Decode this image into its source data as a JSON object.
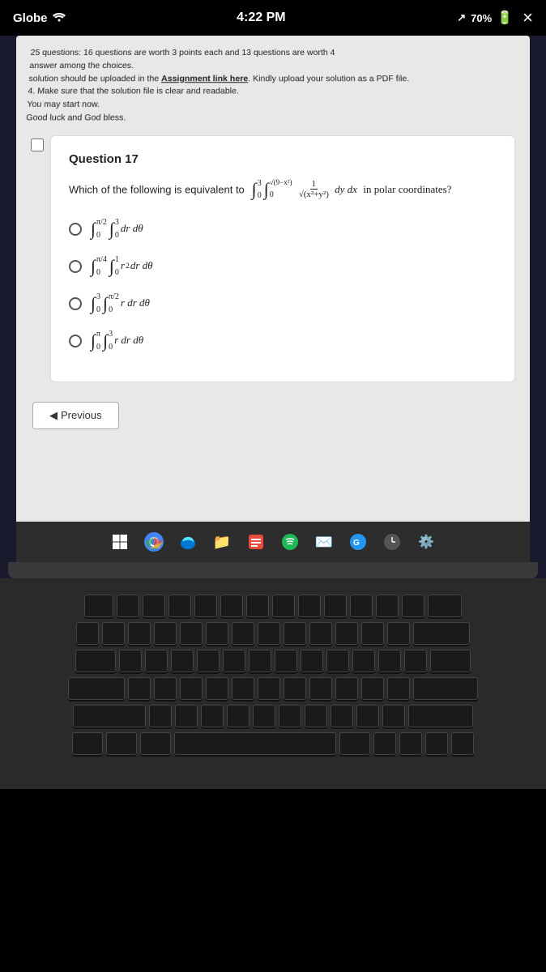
{
  "statusBar": {
    "carrier": "Globe",
    "time": "4:22 PM",
    "battery": "70%",
    "signal_icon": "signal",
    "wifi_icon": "wifi",
    "battery_icon": "battery",
    "close_label": "×"
  },
  "instructions": {
    "line1": "25 questions: 16 questions are worth 3 points each and 13 questions are worth 4",
    "line2": "answer among the choices.",
    "line3": "solution should be uploaded in the Assignment link here. Kindly upload your solution as a PDF file.",
    "line4": "Make sure that the solution file is clear and readable.",
    "line5": "You may start now.",
    "line6": "Good luck and God bless.",
    "assignment_link": "Assignment link here"
  },
  "question": {
    "number": "Question 17",
    "text": "Which of the following is equivalent to",
    "integral_text": "∫₀³ ∫₀^√(9−x²)  1/√(x²+y²)  dy dx in polar coordinates?",
    "options": [
      {
        "id": "A",
        "math": "∫₀^(π/2) ∫₀³ dr dθ"
      },
      {
        "id": "B",
        "math": "∫₀^(π/4) ∫₀¹ r² dr dθ"
      },
      {
        "id": "C",
        "math": "∫₀³ ∫₀^(π/2) r dr dθ"
      },
      {
        "id": "D",
        "math": "∫₀^π ∫₀³ r dr dθ"
      }
    ]
  },
  "navigation": {
    "previous_label": "◀ Previous"
  },
  "taskbar": {
    "icons": [
      "⊞",
      "⬤",
      "⬤",
      "⬤",
      "⬤",
      "⬤",
      "⬤",
      "⬤",
      "⬤"
    ]
  }
}
